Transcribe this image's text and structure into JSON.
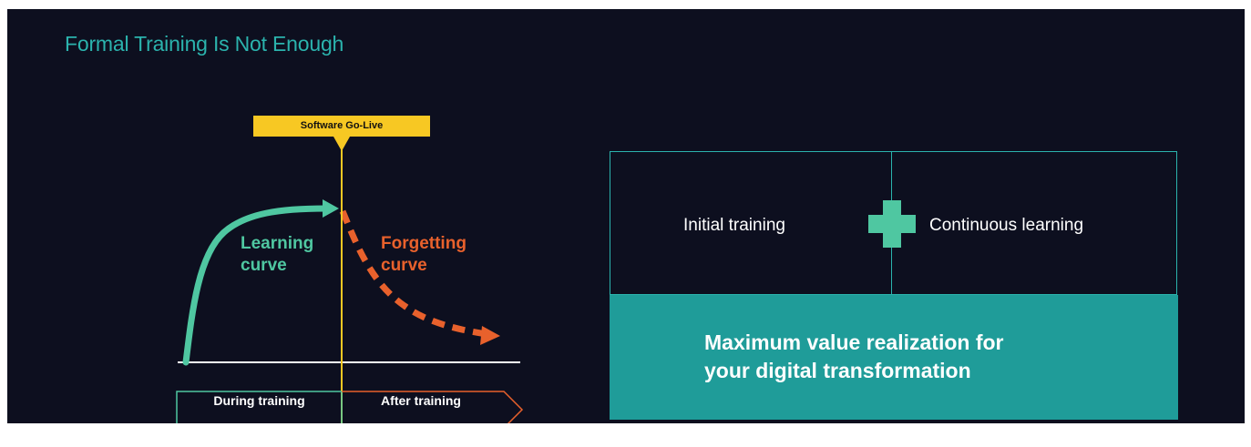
{
  "title": "Formal Training Is Not Enough",
  "diagram": {
    "golive_label": "Software Go-Live",
    "learning_curve_label": [
      "Learning",
      "curve"
    ],
    "forgetting_curve_label": [
      "Forgetting",
      "curve"
    ],
    "phase_during": "During training",
    "phase_after": "After training"
  },
  "panel": {
    "initial_training": "Initial training",
    "continuous_learning": "Continuous learning",
    "result_line1": "Maximum value realization for",
    "result_line2": "your digital transformation"
  },
  "colors": {
    "background": "#0d0f1f",
    "teal": "#2bb3ad",
    "green": "#4fc7a1",
    "orange": "#e8612c",
    "yellow": "#f7c823",
    "result_fill": "#1f9c99"
  }
}
